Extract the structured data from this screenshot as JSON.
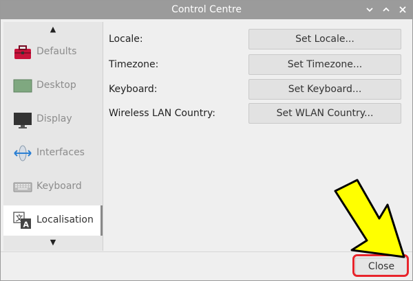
{
  "window": {
    "title": "Control Centre",
    "controls": [
      "chevron-down-icon",
      "chevron-up-icon",
      "close-icon"
    ]
  },
  "sidebar": {
    "scroll_up": "▲",
    "scroll_down": "▼",
    "items": [
      {
        "label": "Defaults",
        "icon": "toolbox-icon"
      },
      {
        "label": "Desktop",
        "icon": "desktop-icon"
      },
      {
        "label": "Display",
        "icon": "monitor-icon"
      },
      {
        "label": "Interfaces",
        "icon": "interfaces-icon"
      },
      {
        "label": "Keyboard",
        "icon": "keyboard-icon"
      },
      {
        "label": "Localisation",
        "icon": "translate-icon",
        "active": true
      }
    ]
  },
  "localisation": {
    "rows": [
      {
        "label": "Locale:",
        "button": "Set Locale..."
      },
      {
        "label": "Timezone:",
        "button": "Set Timezone..."
      },
      {
        "label": "Keyboard:",
        "button": "Set Keyboard..."
      },
      {
        "label": "Wireless LAN Country:",
        "button": "Set WLAN Country..."
      }
    ]
  },
  "footer": {
    "close_label": "Close"
  },
  "colors": {
    "titlebar": "#9b9b9b",
    "highlight": "#e8242b",
    "arrow": "#ffff00"
  }
}
